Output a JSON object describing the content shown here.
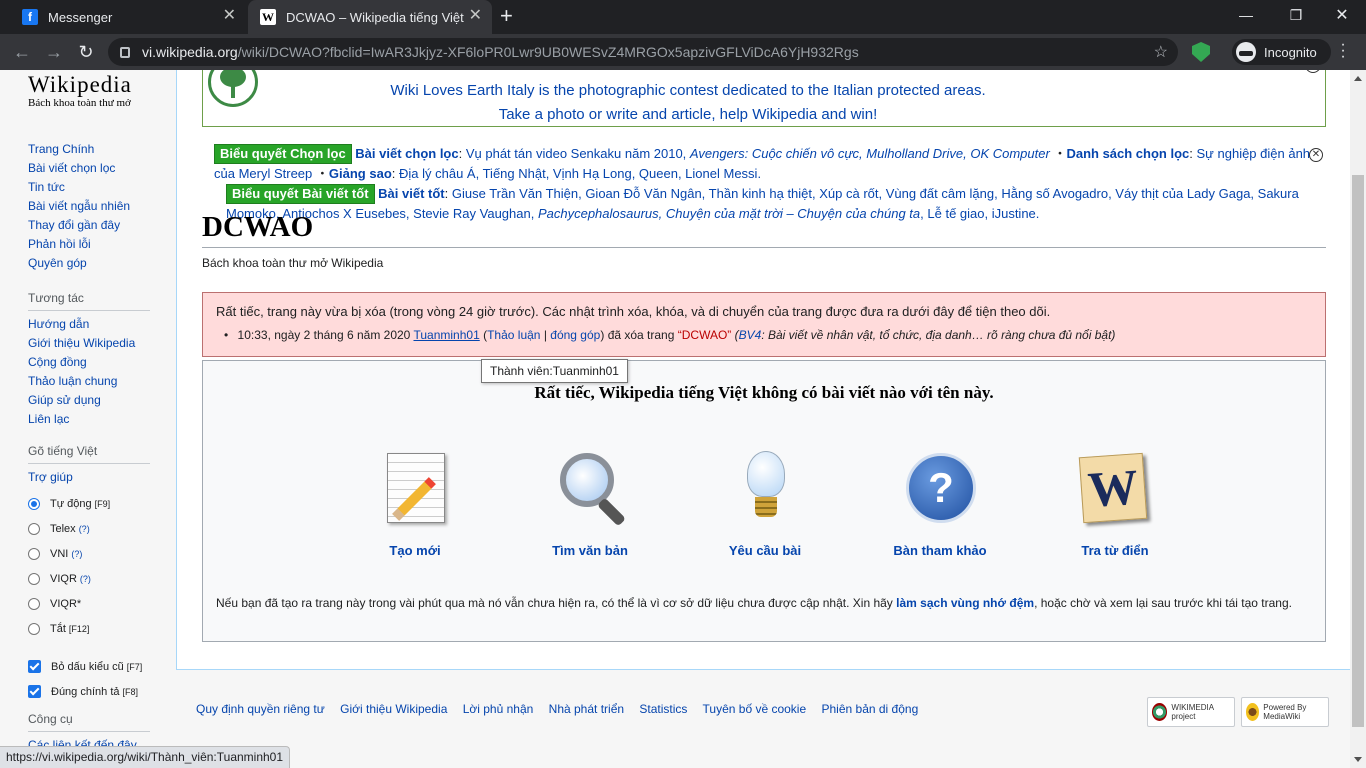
{
  "browser": {
    "tabs": [
      {
        "title": "Messenger",
        "favicon": "facebook-icon"
      },
      {
        "title": "DCWAO – Wikipedia tiếng Việt",
        "favicon": "wikipedia-icon"
      }
    ],
    "url_host": "vi.wikipedia.org",
    "url_path": "/wiki/DCWAO?fbclid=IwAR3Jkjyz-XF6loPR0Lwr9UB0WESvZ4MRGOx5apzivGFLViDcA6YjH932Rgs",
    "incognito_label": "Incognito",
    "status_url": "https://vi.wikipedia.org/wiki/Thành_viên:Tuanminh01"
  },
  "logo": {
    "wordmark": "Wikipedia",
    "tagline": "Bách khoa toàn thư mở"
  },
  "sidebar": {
    "nav": [
      "Trang Chính",
      "Bài viết chọn lọc",
      "Tin tức",
      "Bài viết ngẫu nhiên",
      "Thay đổi gần đây",
      "Phản hồi lỗi",
      "Quyên góp"
    ],
    "interact_heading": "Tương tác",
    "interact": [
      "Hướng dẫn",
      "Giới thiệu Wikipedia",
      "Cộng đồng",
      "Thảo luận chung",
      "Giúp sử dụng",
      "Liên lạc"
    ],
    "typing_heading": "Gõ tiếng Việt",
    "typing_help": "Trợ giúp",
    "typing_modes": [
      {
        "label": "Tự động",
        "hint": "[F9]"
      },
      {
        "label": "Telex",
        "hint": "(?)"
      },
      {
        "label": "VNI",
        "hint": "(?)"
      },
      {
        "label": "VIQR",
        "hint": "(?)"
      },
      {
        "label": "VIQR*",
        "hint": ""
      },
      {
        "label": "Tắt",
        "hint": "[F12]"
      }
    ],
    "checks": [
      {
        "label": "Bỏ dấu kiểu cũ",
        "hint": "[F7]"
      },
      {
        "label": "Đúng chính tả",
        "hint": "[F8]"
      }
    ],
    "tools_heading": "Công cụ",
    "tools_first": "Các liên kết đến đây"
  },
  "banner": {
    "line1": "Wiki Loves Earth Italy is the photographic contest dedicated to the Italian protected areas.",
    "line2": "Take a photo or write and article, help Wikipedia and win!"
  },
  "vote": {
    "fa_label": "Biểu quyết Chọn lọc",
    "fa_title": "Bài viết chọn lọc",
    "fa_items": "Vụ phát tán video Senkaku năm 2010,",
    "fa_italic": "Avengers: Cuộc chiến vô cực, Mulholland Drive, OK Computer",
    "fl_title": "Danh sách chọn lọc",
    "fl_items": "Sự nghiệp điện ảnh của Meryl Streep",
    "fp_title": "Giảng sao",
    "fp_items": "Địa lý châu Á, Tiếng Nhật, Vịnh Hạ Long, Queen, Lionel Messi.",
    "ga_label": "Biểu quyết Bài viết tốt",
    "ga_title": "Bài viết tốt",
    "ga_items": "Giuse Trần Văn Thiện, Gioan Đỗ Văn Ngân, Thần kinh hạ thiệt, Xúp cà rốt, Vùng đất câm lặng, Hằng số Avogadro, Váy thịt của Lady Gaga, Sakura Momoko, Antiochos X Eusebes, Stevie Ray Vaughan,",
    "ga_italic": "Pachycephalosaurus, Chuyện của mặt trời – Chuyện của chúng ta",
    "ga_tail": ", Lễ tế giao, iJustine."
  },
  "page": {
    "title": "DCWAO",
    "subtitle": "Bách khoa toàn thư mở Wikipedia"
  },
  "deletion": {
    "message": "Rất tiếc, trang này vừa bị xóa (trong vòng 24 giờ trước). Các nhật trình xóa, khóa, và di chuyển của trang được đưa ra dưới đây để tiện theo dõi.",
    "time": "10:33, ngày 2 tháng 6 năm 2020",
    "user": "Tuanminh01",
    "talk": "Thảo luận",
    "pipe": "|",
    "contribs": "đóng góp",
    "action": "đã xóa trang",
    "page": "“DCWAO”",
    "reason_code": "BV4",
    "reason": ": Bài viết về nhân vật, tổ chức, địa danh… rõ ràng chưa đủ nổi bật"
  },
  "tooltip": "Thành viên:Tuanminh01",
  "noarticle": {
    "heading": "Rất tiếc, Wikipedia tiếng Việt không có bài viết nào với tên này.",
    "options": [
      {
        "label": "Tạo mới",
        "icon": "pencil-document-icon"
      },
      {
        "label": "Tìm văn bản",
        "icon": "magnifier-icon"
      },
      {
        "label": "Yêu cầu bài",
        "icon": "lightbulb-icon"
      },
      {
        "label": "Bàn tham khảo",
        "icon": "question-icon"
      },
      {
        "label": "Tra từ điển",
        "icon": "wiktionary-icon"
      }
    ],
    "note_a": "Nếu bạn đã tạo ra trang này trong vài phút qua mà nó vẫn chưa hiện ra, có thể là vì cơ sở dữ liệu chưa được cập nhật. Xin hãy",
    "note_link": "làm sạch vùng nhớ đệm",
    "note_b": ", hoặc chờ và xem lại sau trước khi tái tạo trang."
  },
  "footer": {
    "links": [
      "Quy định quyền riêng tư",
      "Giới thiệu Wikipedia",
      "Lời phủ nhận",
      "Nhà phát triển",
      "Statistics",
      "Tuyên bố về cookie",
      "Phiên bản di động"
    ],
    "badge_wikimedia": "WIKIMEDIA project",
    "badge_mediawiki": "Powered By MediaWiki"
  },
  "colors": {
    "link": "#0645ad",
    "vote_green": "#28a428",
    "deleted_bg": "#ffdbdb"
  }
}
